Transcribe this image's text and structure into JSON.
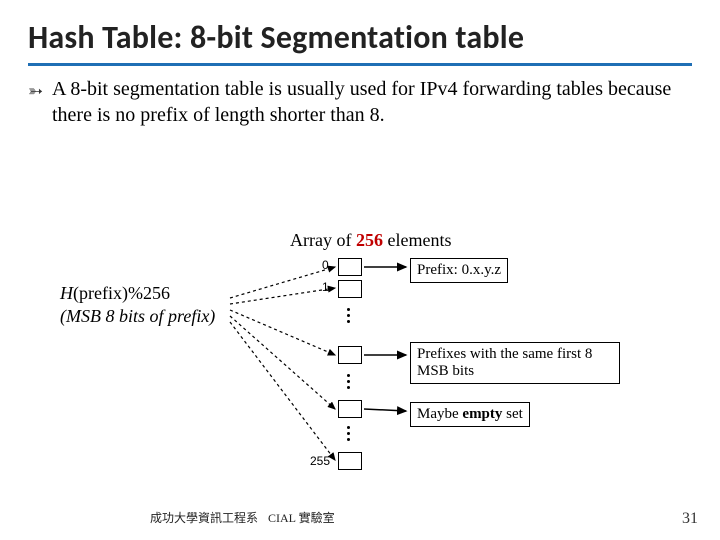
{
  "title": "Hash Table: 8-bit Segmentation table",
  "bullet_glyph": "➳",
  "body": "A 8-bit segmentation table is usually used for IPv4 forwarding tables because there is no prefix of length shorter than 8.",
  "diagram": {
    "array_title_pre": "Array of ",
    "array_title_red": "256",
    "array_title_post": " elements",
    "idx0": "0",
    "idx1": "1",
    "idx255": "255",
    "hash_line1_pre": "H",
    "hash_line1_paren": "(prefix)",
    "hash_line1_mod": "%256",
    "hash_line2": "(MSB 8 bits of prefix)",
    "box1": "Prefix: 0.x.y.z",
    "box2": "Prefixes with the same first 8 MSB bits",
    "box3_pre": "Maybe ",
    "box3_bold": "empty",
    "box3_post": " set"
  },
  "footer": {
    "left": "成功大學資訊工程系",
    "right": "CIAL 實驗室"
  },
  "page": "31"
}
